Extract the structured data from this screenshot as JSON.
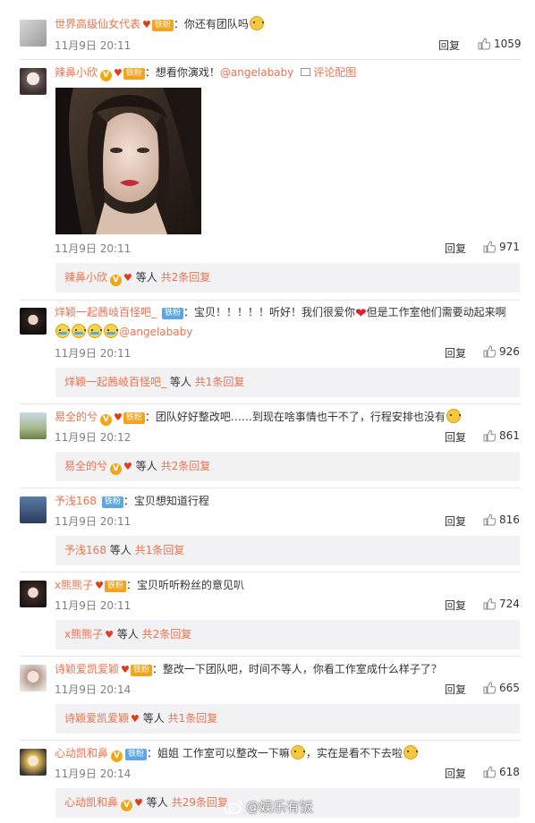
{
  "comments": [
    {
      "user": "世界高级仙女代表",
      "fan_label": "铁粉",
      "text": "：你还有团队吗",
      "time": "11月9日 20:11",
      "reply": "回复",
      "likes": "1059"
    },
    {
      "user": "辣鼻小欣",
      "fan_label": "铁粉",
      "text": "：想看你演戏！",
      "mention": "@angelababy",
      "pic_link": "评论配图",
      "time": "11月9日 20:11",
      "reply": "回复",
      "likes": "971",
      "sub": {
        "user": "辣鼻小欣",
        "mid": "等人",
        "more": "共2条回复"
      }
    },
    {
      "user": "烊颖一起茜岐百怪吧_",
      "fan_label": "铁粉",
      "text": "：宝贝！！！！！听好！我们很爱你",
      "text2": "但是工作室他们需要动起来啊",
      "mention": "@angelababy",
      "time": "11月9日 20:11",
      "reply": "回复",
      "likes": "926",
      "sub": {
        "user": "烊颖一起茜岐百怪吧_",
        "mid": "等人",
        "more": "共1条回复"
      }
    },
    {
      "user": "易全的兮",
      "fan_label": "铁粉",
      "text": "：团队好好整改吧……到现在啥事情也干不了，行程安排也没有",
      "time": "11月9日 20:12",
      "reply": "回复",
      "likes": "861",
      "sub": {
        "user": "易全的兮",
        "mid": "等人",
        "more": "共2条回复"
      }
    },
    {
      "user": "予浅168",
      "fan_label": "铁粉",
      "text": "：宝贝想知道行程",
      "time": "11月9日 20:11",
      "reply": "回复",
      "likes": "816",
      "sub": {
        "user": "予浅168",
        "mid": "等人",
        "more": "共1条回复"
      }
    },
    {
      "user": "x熊熊子",
      "fan_label": "铁粉",
      "text": "：宝贝听听粉丝的意见叭",
      "time": "11月9日 20:11",
      "reply": "回复",
      "likes": "724",
      "sub": {
        "user": "x熊熊子",
        "mid": "等人",
        "more": "共2条回复"
      }
    },
    {
      "user": "诗颖爱凯爱颖",
      "fan_label": "铁粉",
      "text": "：整改一下团队吧，时间不等人，你看工作室成什么样子了？",
      "time": "11月9日 20:14",
      "reply": "回复",
      "likes": "665",
      "sub": {
        "user": "诗颖爱凯爱颖",
        "mid": "等人",
        "more": "共1条回复"
      }
    },
    {
      "user": "心动凯和鼻",
      "fan_label": "铁粉",
      "text": "：姐姐 工作室可以整改一下嘛",
      "text2": "，实在是看不下去啦",
      "time": "11月9日 20:14",
      "reply": "回复",
      "likes": "618",
      "sub": {
        "user": "心动凯和鼻",
        "mid": "等人",
        "more": "共29条回复"
      }
    }
  ],
  "watermark": "@娱乐有饭",
  "colors": {
    "link": "#eb7350",
    "sub_bg": "#f2f2f5",
    "fan_gold": "#f4a31d",
    "fan_blue": "#5da6e1"
  }
}
